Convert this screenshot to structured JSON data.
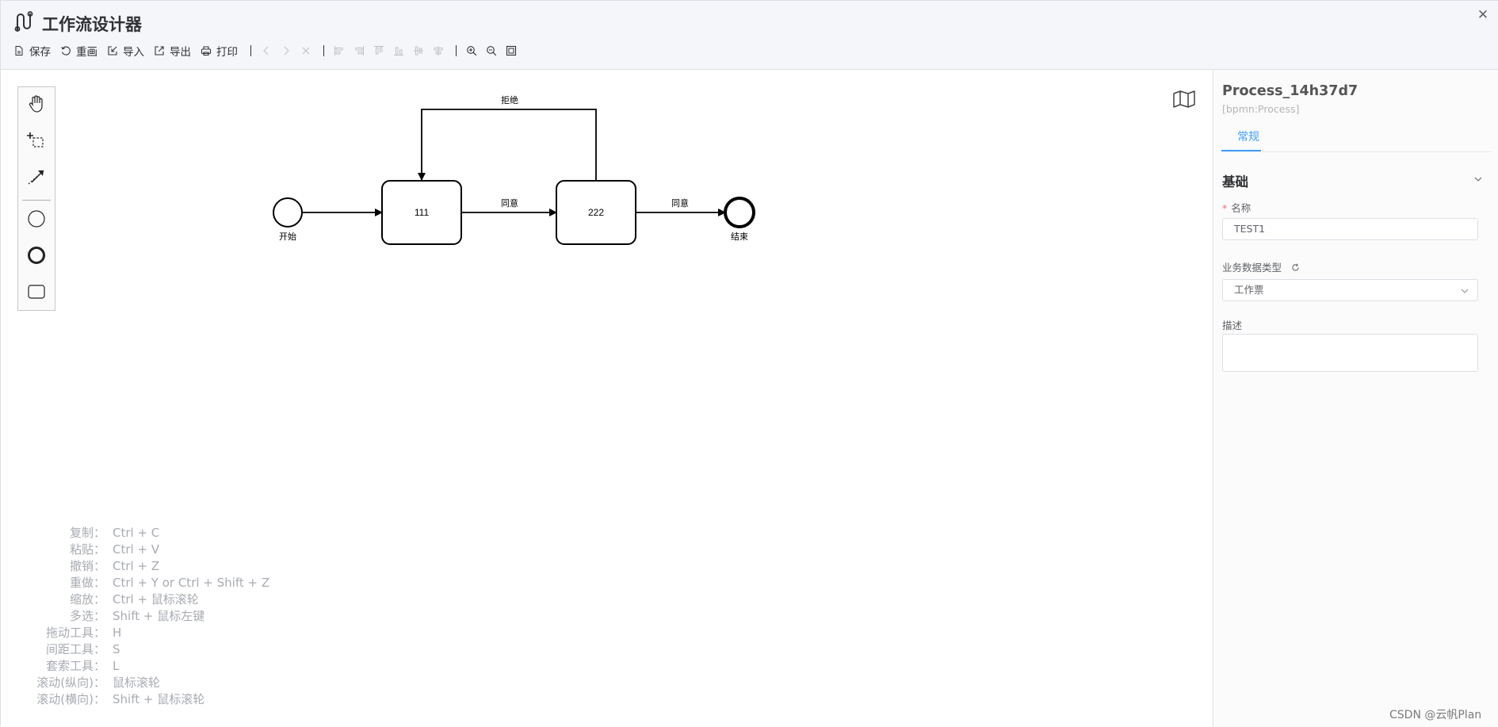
{
  "header": {
    "title": "工作流设计器",
    "close_icon": "close-icon",
    "toolbar": {
      "save": "保存",
      "redraw": "重画",
      "import": "导入",
      "export": "导出",
      "print": "打印"
    }
  },
  "diagram": {
    "start_label": "开始",
    "task1_label": "111",
    "task2_label": "222",
    "end_label": "结束",
    "flow_agree1": "同意",
    "flow_agree2": "同意",
    "flow_reject": "拒绝"
  },
  "shortcuts": [
    {
      "key": "复制：",
      "value": "Ctrl + C"
    },
    {
      "key": "粘贴：",
      "value": "Ctrl + V"
    },
    {
      "key": "撤销：",
      "value": "Ctrl + Z"
    },
    {
      "key": "重做：",
      "value": "Ctrl + Y or Ctrl + Shift + Z"
    },
    {
      "key": "缩放：",
      "value": "Ctrl + 鼠标滚轮"
    },
    {
      "key": "多选：",
      "value": "Shift + 鼠标左键"
    },
    {
      "key": "拖动工具：",
      "value": "H"
    },
    {
      "key": "间距工具：",
      "value": "S"
    },
    {
      "key": "套索工具：",
      "value": "L"
    },
    {
      "key": "滚动(纵向)：",
      "value": "鼠标滚轮"
    },
    {
      "key": "滚动(横向)：",
      "value": "Shift + 鼠标滚轮"
    }
  ],
  "panel": {
    "title": "Process_14h37d7",
    "subtitle": "[bpmn:Process]",
    "tab": "常规",
    "section": "基础",
    "name_label": "名称",
    "name_value": "TEST1",
    "type_label": "业务数据类型",
    "type_value": "工作票",
    "desc_label": "描述",
    "desc_value": ""
  },
  "watermark": "CSDN @云帆Plan"
}
